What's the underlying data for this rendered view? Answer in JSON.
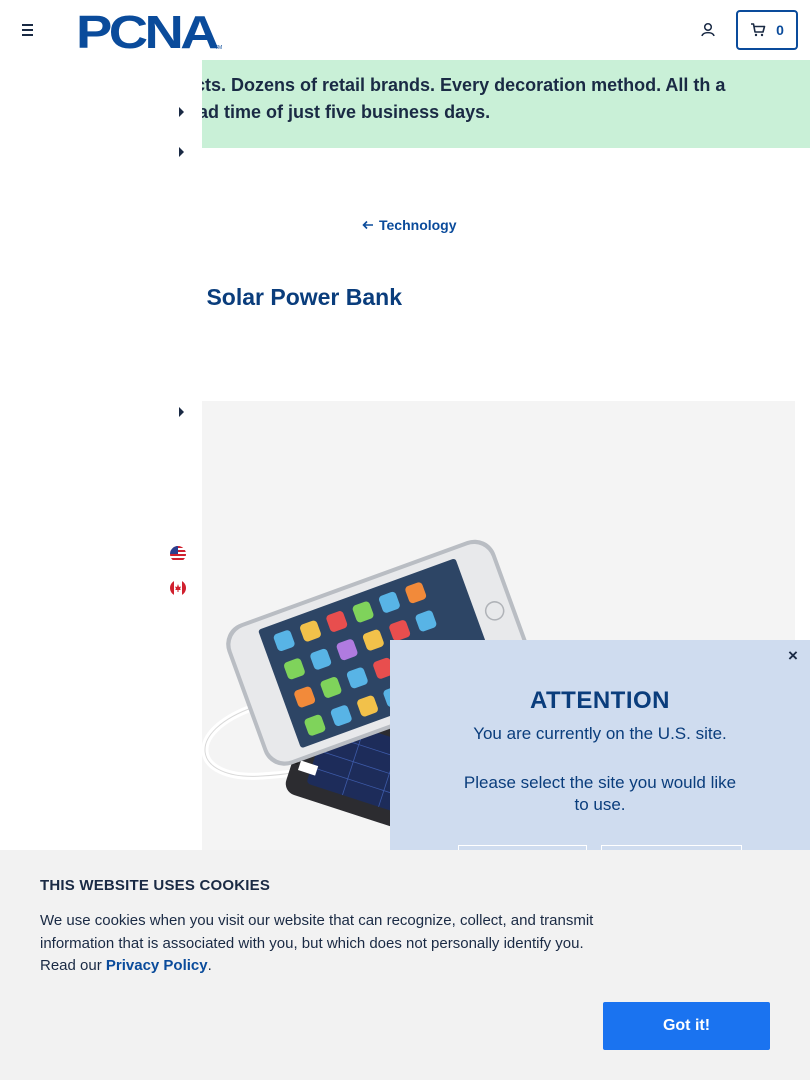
{
  "header": {
    "logo_text": "PCNA",
    "logo_tm": "TM",
    "cart_count": "0"
  },
  "promo": {
    "text": "ls of products. Dozens of retail brands. Every decoration method. All th a standard lead time of just five business days."
  },
  "breadcrumb": {
    "back_label": "Technology"
  },
  "product": {
    "title": "n Solar Power Bank"
  },
  "site_modal": {
    "title": "ATTENTION",
    "current_site_text": "You are currently on the U.S. site.",
    "prompt_text": "Please select the site you would like to use.",
    "close_symbol": "×"
  },
  "cookies": {
    "title": "THIS WEBSITE USES COOKIES",
    "text_before": "We use cookies when you visit our website that can recognize, collect, and transmit information that is associated with you, but which does not personally identify you. Read our ",
    "link_label": "Privacy Policy",
    "text_after": ".",
    "accept_label": "Got it!"
  },
  "colors": {
    "brand_blue": "#0a4b9b",
    "promo_green": "#c9f0d7",
    "modal_blue": "#cfdcef",
    "cookie_button": "#1a73f0"
  },
  "icons": [
    "hamburger-menu-icon",
    "account-icon",
    "cart-icon",
    "arrow-left-icon",
    "caret-right-icon",
    "us-flag-icon",
    "canada-flag-icon",
    "close-icon"
  ]
}
